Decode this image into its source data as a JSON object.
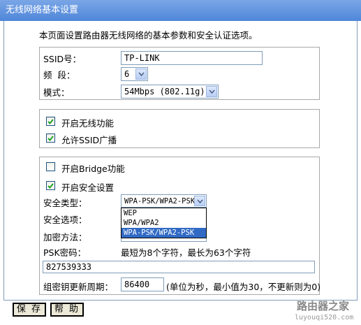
{
  "title": "无线网络基本设置",
  "description": "本页面设置路由器无线网络的基本参数和安全认证选项。",
  "basic": {
    "ssid_label": "SSID号：",
    "ssid_value": "TP-LINK",
    "channel_label": "频  段：",
    "channel_value": "6",
    "mode_label": "模式：",
    "mode_value": "54Mbps (802.11g)"
  },
  "wireless": {
    "enable_label": "开启无线功能",
    "enable_checked": true,
    "ssid_broadcast_label": "允许SSID广播",
    "ssid_broadcast_checked": true
  },
  "security": {
    "bridge_label": "开启Bridge功能",
    "bridge_checked": false,
    "security_enable_label": "开启安全设置",
    "security_enable_checked": true,
    "type_label": "安全类型：",
    "type_value": "WPA-PSK/WPA2-PSK",
    "type_options": [
      "WEP",
      "WPA/WPA2",
      "WPA-PSK/WPA2-PSK"
    ],
    "type_selected_index": 2,
    "option_label": "安全选项：",
    "encryption_label": "加密方法：",
    "psk_label": "PSK密码：",
    "psk_hint": "最短为8个字符，最长为63个字符",
    "psk_value": "827539333",
    "rekey_label": "组密钥更新周期：",
    "rekey_value": "86400",
    "rekey_hint": "(单位为秒，最小值为30，不更新则为0)"
  },
  "buttons": {
    "save_label": "保 存",
    "help_label": "帮 助"
  },
  "watermark": {
    "brand": "路由器之家",
    "url": "luyouqi520.com"
  },
  "colors": {
    "titlebar": "#5b8fdc",
    "selection": "#316ac5",
    "checkmark": "#21a121"
  }
}
